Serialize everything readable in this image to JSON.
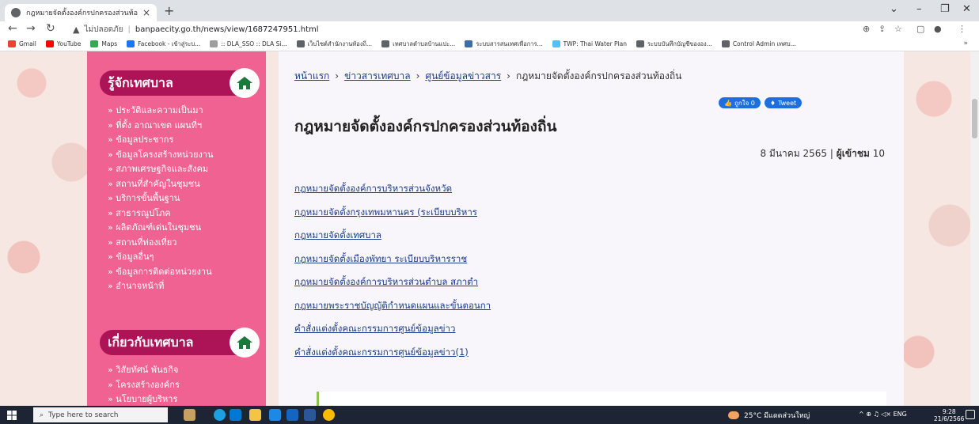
{
  "browser": {
    "tab_title": "กฎหมายจัดตั้งองค์กรปกครองส่วนท้องถิ่",
    "tab_close": "×",
    "new_tab": "+",
    "not_secure_label": "ไม่ปลอดภัย",
    "url": "banpaecity.go.th/news/view/1687247951.html",
    "controls": {
      "chevron": "⌄",
      "minimize": "–",
      "restore": "❐",
      "close": "✕"
    },
    "nav": {
      "back": "←",
      "forward": "→",
      "reload": "↻"
    },
    "bookmarks": [
      {
        "label": "Gmail",
        "color": "#ea4335"
      },
      {
        "label": "YouTube",
        "color": "#ff0000"
      },
      {
        "label": "Maps",
        "color": "#34a853"
      },
      {
        "label": "Facebook - เข้าสู่ระบ...",
        "color": "#1877f2"
      },
      {
        "label": ":: DLA_SSO :: DLA Si...",
        "color": "#9e9e9e"
      },
      {
        "label": "เว็บไซต์สำนักงานท้องถิ่...",
        "color": "#5f6368"
      },
      {
        "label": "เทศบาลตำบลบ้านแปะ...",
        "color": "#5f6368"
      },
      {
        "label": "ระบบสารสนเทศเพื่อการ...",
        "color": "#3b6ea8"
      },
      {
        "label": "TWP: Thai Water Plan",
        "color": "#4fc3f7"
      },
      {
        "label": "ระบบบันทึกบัญชีขององ...",
        "color": "#5f6368"
      },
      {
        "label": "Control Admin เทศบ...",
        "color": "#5f6368"
      }
    ],
    "bookmarks_more": "»"
  },
  "sidebar": {
    "section1_title": "รู้จักเทศบาล",
    "section1_items": [
      "» ประวัติและความเป็นมา",
      "» ที่ตั้ง อาณาเขต แผนที่ฯ",
      "» ข้อมูลประชากร",
      "» ข้อมูลโครงสร้างหน่วยงาน",
      "» สภาพเศรษฐกิจและสังคม",
      "» สถานที่สำคัญในชุมชน",
      "» บริการขั้นพื้นฐาน",
      "» สาธารณูปโภค",
      "» ผลิตภัณฑ์เด่นในชุมชน",
      "» สถานที่ท่องเที่ยว",
      "» ข้อมูลอื่นๆ",
      "» ข้อมูลการติดต่อหน่วยงาน",
      "» อำนาจหน้าที่"
    ],
    "section2_title": "เกี่ยวกับเทศบาล",
    "section2_items": [
      "» วิสัยทัศน์ พันธกิจ",
      "» โครงสร้างองค์กร",
      "» นโยบายผู้บริหาร"
    ]
  },
  "content": {
    "breadcrumb": {
      "home": "หน้าแรก",
      "news": "ข่าวสารเทศบาล",
      "info_center": "ศูนย์ข้อมูลข่าวสาร",
      "current": "กฎหมายจัดตั้งองค์กรปกครองส่วนท้องถิ่น",
      "separator": "›"
    },
    "like_label": "ถูกใจ 0",
    "tweet_label": "Tweet",
    "title": "กฎหมายจัดตั้งองค์กรปกครองส่วนท้องถิ่น",
    "date": "8 มีนาคม 2565 |",
    "visitors_label": "ผู้เข้าชม",
    "visitors_count": "10",
    "links": [
      "กฎหมายจัดตั้งองค์การบริหารส่วนจังหวัด",
      "กฎหมายจัดตั้งกรุงเทพมหานคร (ระเบียบบริหาร",
      "กฎหมายจัดตั้งเทศบาล",
      "กฎหมายจัดตั้งเมืองพัทยา ระเบียบบริหารราช",
      "กฎหมายจัดตั้งองค์การบริหารส่วนตำบล สภาตำ",
      "กฎหมายพระราชบัญญัติกำหนดแผนและขั้นตอนกา",
      "คำสั่งแต่งตั้งคณะกรรมการศูนย์ข้อมูลข่าว",
      "คำสั่งแต่งตั้งคณะกรรมการศูนย์ข้อมูลข่าว(1)"
    ]
  },
  "taskbar": {
    "search_placeholder": "Type here to search",
    "weather": "25°C มีแดดส่วนใหญ่",
    "tray": "^ ⊕ ♫ ◁× ENG",
    "time": "9:28",
    "date": "21/6/2566"
  }
}
